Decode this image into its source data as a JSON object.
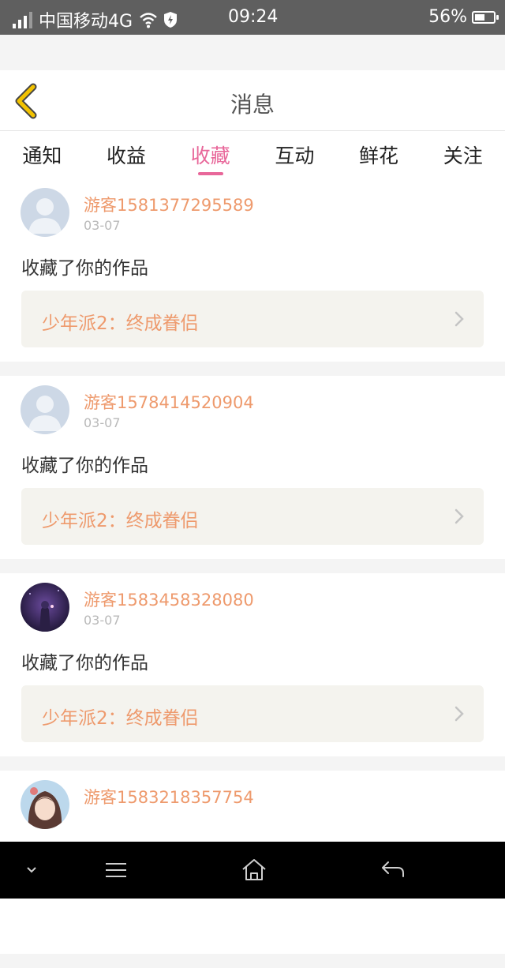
{
  "status_bar": {
    "carrier": "中国移动4G",
    "time": "09:24",
    "battery": "56%",
    "battery_level": 0.56
  },
  "header": {
    "title": "消息",
    "back_icon": "chevron-left-icon"
  },
  "tabs": [
    {
      "label": "通知",
      "active": false
    },
    {
      "label": "收益",
      "active": false
    },
    {
      "label": "收藏",
      "active": true
    },
    {
      "label": "互动",
      "active": false
    },
    {
      "label": "鲜花",
      "active": false
    },
    {
      "label": "关注",
      "active": false
    }
  ],
  "items": [
    {
      "user": "游客1581377295589",
      "date": "03-07",
      "action": "收藏了你的作品",
      "work": "少年派2：终成眷侣",
      "avatar": "default-avatar"
    },
    {
      "user": "游客1578414520904",
      "date": "03-07",
      "action": "收藏了你的作品",
      "work": "少年派2：终成眷侣",
      "avatar": "default-avatar"
    },
    {
      "user": "游客1583458328080",
      "date": "03-07",
      "action": "收藏了你的作品",
      "work": "少年派2：终成眷侣",
      "avatar": "night-girl-avatar"
    },
    {
      "user": "游客1583218357754",
      "date": "",
      "action": "",
      "work": "",
      "avatar": "anime-girl-avatar"
    }
  ],
  "nav_bar": {
    "icons": [
      "chevron-down-icon",
      "menu-icon",
      "home-icon",
      "back-arrow-icon"
    ]
  },
  "colors": {
    "accent": "#e8679a",
    "username": "#ee9a6d",
    "back_icon": "#f2c200"
  }
}
